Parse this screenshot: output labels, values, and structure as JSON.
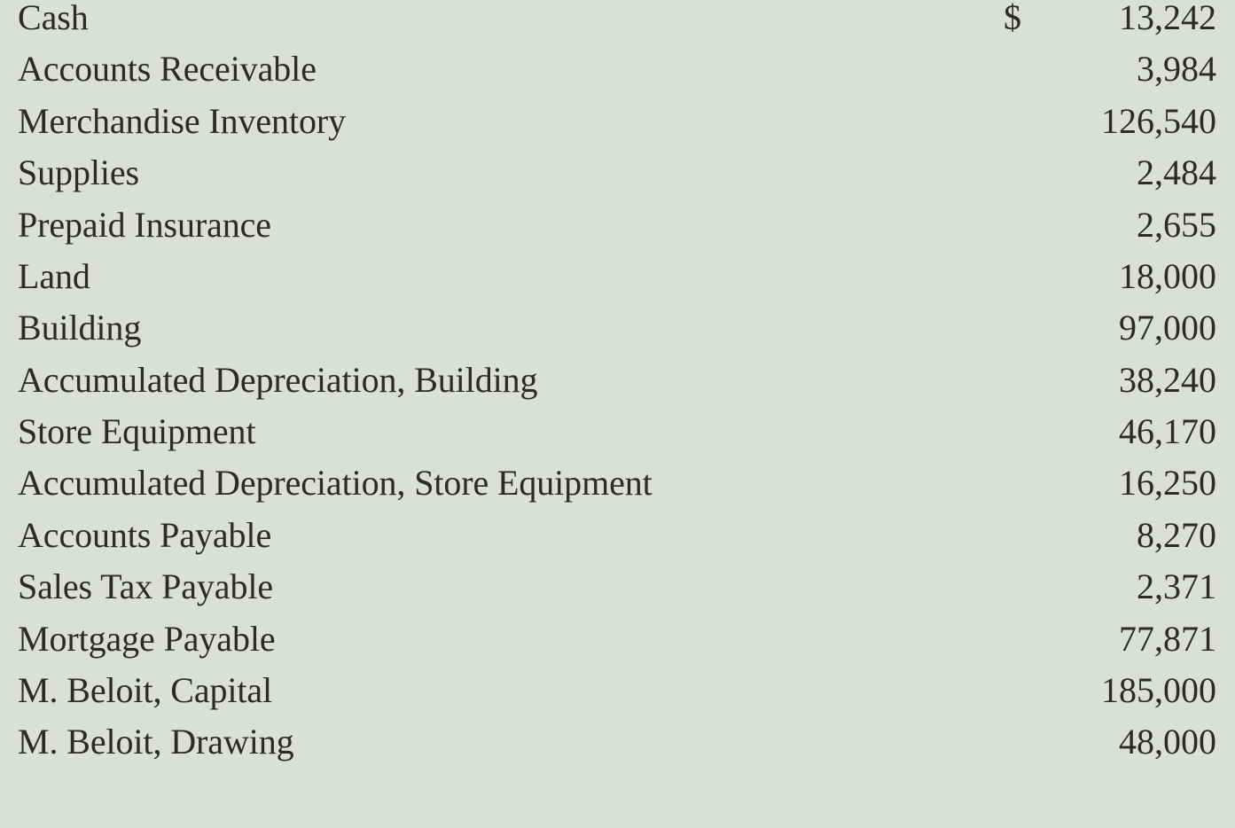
{
  "document": {
    "type": "account-balance-listing",
    "currency_symbol": "$",
    "background_color": "#dadfd8",
    "text_color": "#2e2a24"
  },
  "rows": [
    {
      "name": "Cash",
      "symbol": "$",
      "amount": "13,242"
    },
    {
      "name": "Accounts Receivable",
      "symbol": "",
      "amount": "3,984"
    },
    {
      "name": "Merchandise Inventory",
      "symbol": "",
      "amount": "126,540"
    },
    {
      "name": "Supplies",
      "symbol": "",
      "amount": "2,484"
    },
    {
      "name": "Prepaid Insurance",
      "symbol": "",
      "amount": "2,655"
    },
    {
      "name": "Land",
      "symbol": "",
      "amount": "18,000"
    },
    {
      "name": "Building",
      "symbol": "",
      "amount": "97,000"
    },
    {
      "name": "Accumulated Depreciation, Building",
      "symbol": "",
      "amount": "38,240"
    },
    {
      "name": "Store Equipment",
      "symbol": "",
      "amount": "46,170"
    },
    {
      "name": "Accumulated Depreciation, Store Equipment",
      "symbol": "",
      "amount": "16,250"
    },
    {
      "name": "Accounts Payable",
      "symbol": "",
      "amount": "8,270"
    },
    {
      "name": "Sales Tax Payable",
      "symbol": "",
      "amount": "2,371"
    },
    {
      "name": "Mortgage Payable",
      "symbol": "",
      "amount": "77,871"
    },
    {
      "name": "M. Beloit, Capital",
      "symbol": "",
      "amount": "185,000"
    },
    {
      "name": "M. Beloit, Drawing",
      "symbol": "",
      "amount": "48,000"
    }
  ]
}
